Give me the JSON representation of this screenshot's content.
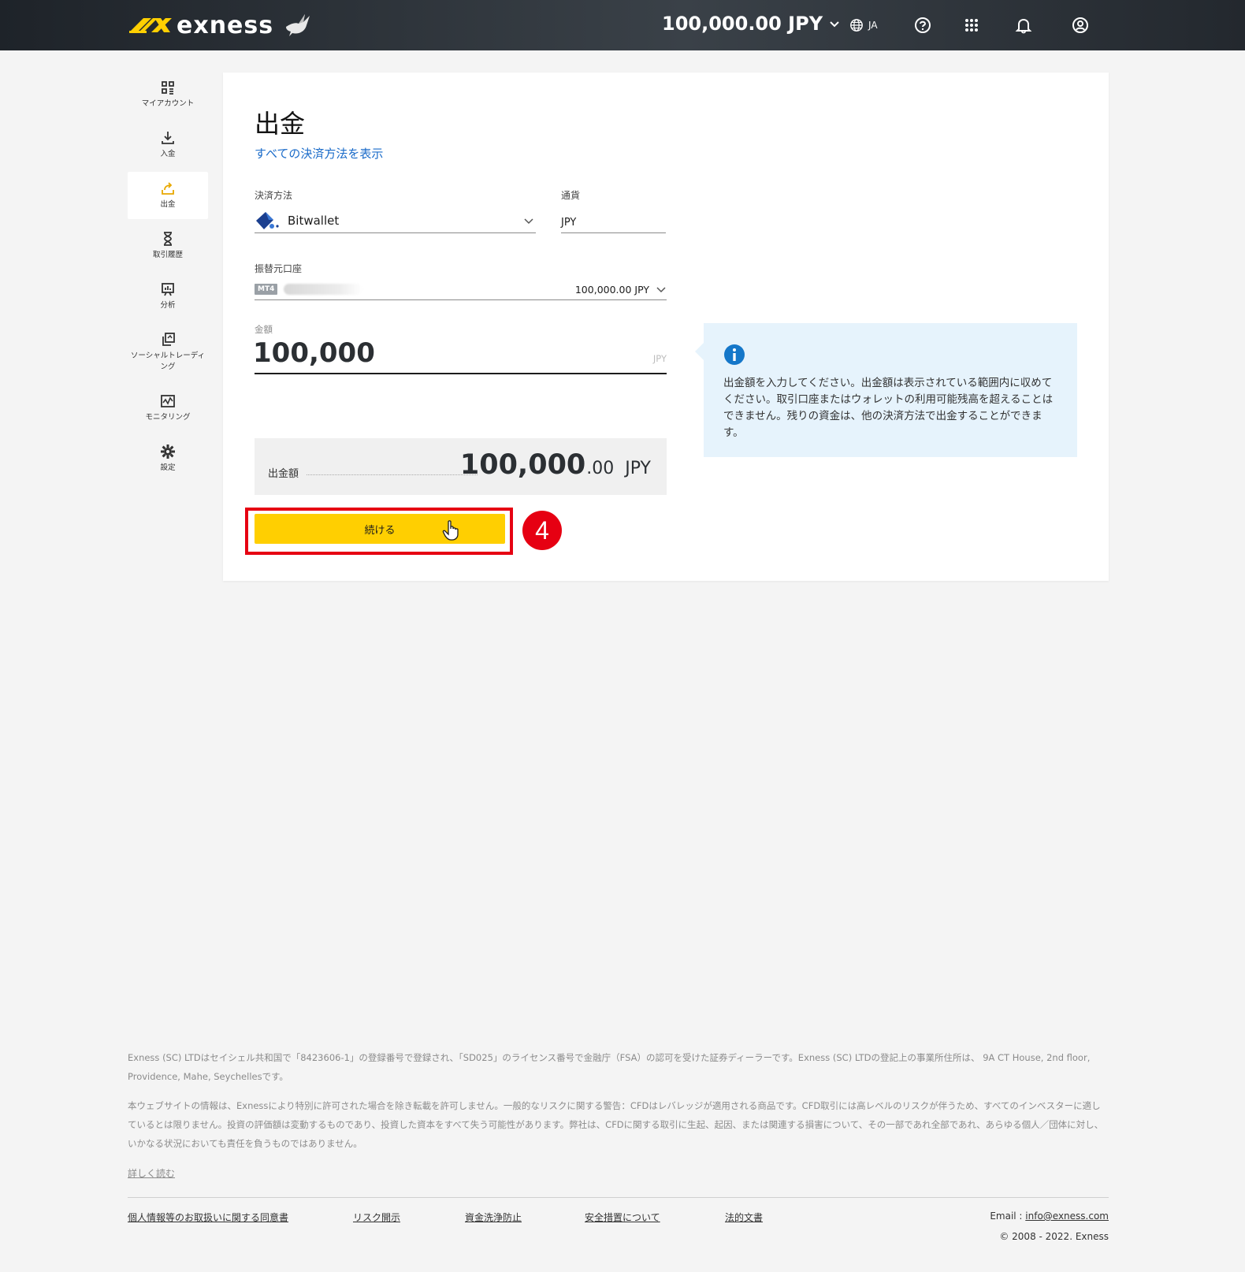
{
  "header": {
    "brand": "exness",
    "balance": "100,000.00 JPY",
    "language": "JA"
  },
  "sidebar": {
    "items": [
      {
        "label": "マイアカウント",
        "icon": "grid-icon"
      },
      {
        "label": "入金",
        "icon": "download-icon"
      },
      {
        "label": "出金",
        "icon": "withdraw-icon",
        "active": true
      },
      {
        "label": "取引履歴",
        "icon": "hourglass-icon"
      },
      {
        "label": "分析",
        "icon": "analytics-icon"
      },
      {
        "label": "ソーシャルトレーディング",
        "icon": "copy-icon"
      },
      {
        "label": "モニタリング",
        "icon": "monitoring-icon"
      },
      {
        "label": "設定",
        "icon": "gear-icon"
      }
    ]
  },
  "main": {
    "title": "出金",
    "all_methods_link": "すべての決済方法を表示",
    "payment_method": {
      "label": "決済方法",
      "value": "Bitwallet"
    },
    "currency": {
      "label": "通貨",
      "value": "JPY"
    },
    "source_account": {
      "label": "振替元口座",
      "badge": "MT4",
      "balance": "100,000.00 JPY"
    },
    "amount": {
      "label": "金額",
      "value": "100,000",
      "unit": "JPY"
    },
    "summary": {
      "label": "出金額",
      "integer": "100,000",
      "decimal": ".00",
      "currency": "JPY"
    },
    "continue_label": "続ける",
    "step_number": "4",
    "info_text": "出金額を入力してください。出金額は表示されている範囲内に収めてください。取引口座またはウォレットの利用可能残高を超えることはできません。残りの資金は、他の決済方法で出金することができます。"
  },
  "footer": {
    "para1": "Exness (SC) LTDはセイシェル共和国で「8423606-1」の登録番号で登録され、「SD025」のライセンス番号で金融庁（FSA）の認可を受けた証券ディーラーです。Exness (SC) LTDの登記上の事業所住所は、 9A CT House, 2nd floor, Providence, Mahe, Seychellesです。",
    "para2": "本ウェブサイトの情報は、Exnessにより特別に許可された場合を除き転載を許可しません。一般的なリスクに関する警告：CFDはレバレッジが適用される商品です。CFD取引には高レベルのリスクが伴うため、すべてのインベスターに適しているとは限りません。投資の評価額は変動するものであり、投資した資本をすべて失う可能性があります。弊社は、CFDに関する取引に生起、起因、または関連する損害について、その一部であれ全部であれ、あらゆる個人／団体に対し、いかなる状況においても責任を負うものではありません。",
    "read_more": "詳しく読む",
    "links": [
      "個人情報等のお取扱いに関する同意書",
      "リスク開示",
      "資金洗浄防止",
      "安全措置について",
      "法的文書"
    ],
    "email_label": "Email : ",
    "email": "info@exness.com",
    "copyright": "© 2008 - 2022. Exness"
  },
  "colors": {
    "accent": "#ffcf01",
    "link": "#1a6bc9",
    "highlight": "#e60012",
    "info_bg": "#e6f3fc"
  }
}
